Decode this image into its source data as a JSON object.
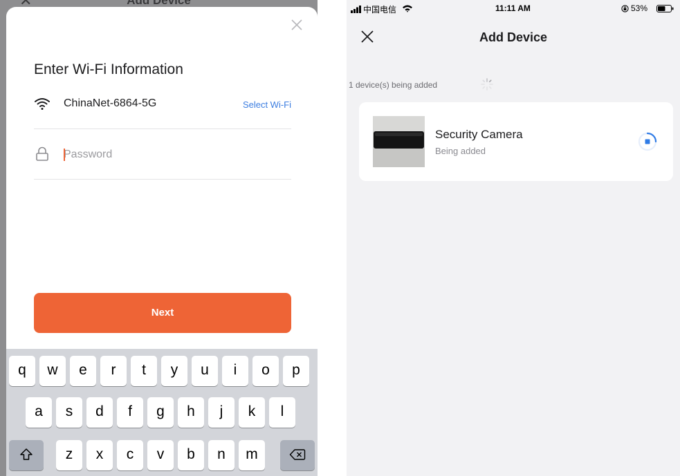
{
  "left_screen": {
    "behind_title": "Add Device",
    "sheet": {
      "title": "Enter Wi-Fi Information",
      "wifi_name": "ChinaNet-6864-5G",
      "select_wifi_label": "Select Wi-Fi",
      "password_placeholder": "Password",
      "password_value": "",
      "next_label": "Next"
    },
    "keyboard": {
      "row1": [
        "q",
        "w",
        "e",
        "r",
        "t",
        "y",
        "u",
        "i",
        "o",
        "p"
      ],
      "row2": [
        "a",
        "s",
        "d",
        "f",
        "g",
        "h",
        "j",
        "k",
        "l"
      ],
      "row3": [
        "z",
        "x",
        "c",
        "v",
        "b",
        "n",
        "m"
      ],
      "shift_icon": "shift-icon",
      "backspace_icon": "backspace-icon"
    }
  },
  "right_screen": {
    "status_bar": {
      "carrier": "中国电信",
      "time": "11:11 AM",
      "battery_percent": "53%"
    },
    "nav_title": "Add Device",
    "adding_text": "1 device(s) being added",
    "device": {
      "name": "Security Camera",
      "status": "Being added"
    }
  },
  "colors": {
    "accent": "#ee6436",
    "link": "#3b7de0",
    "progress": "#2f7be6"
  }
}
